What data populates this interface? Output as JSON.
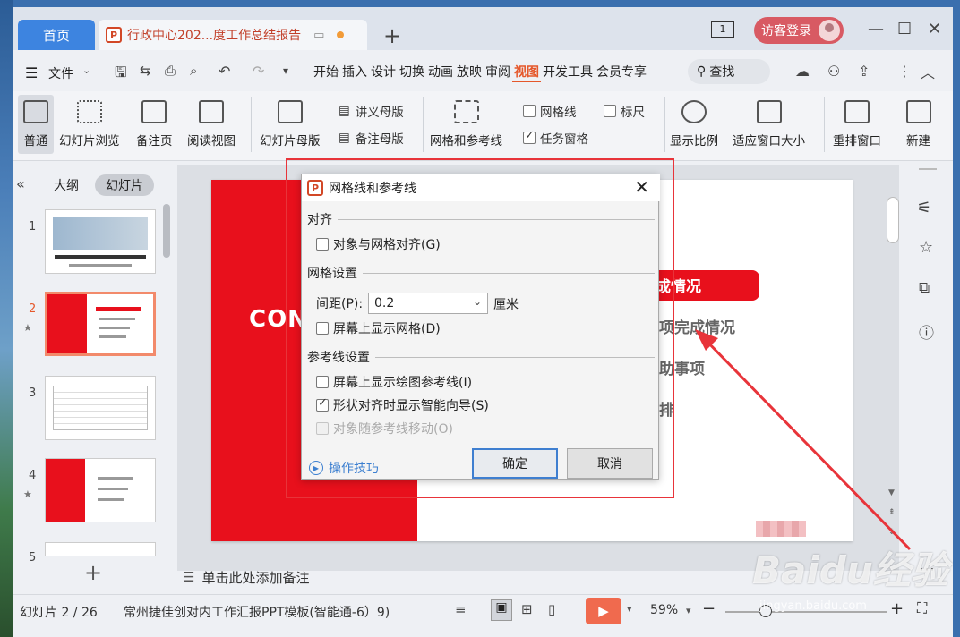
{
  "tabs": {
    "home": "首页",
    "doc": "行政中心202...度工作总结报告"
  },
  "titlebar": {
    "window_count": "1",
    "login": "访客登录"
  },
  "menu": {
    "file": "文件",
    "tabs": [
      "开始",
      "插入",
      "设计",
      "切换",
      "动画",
      "放映",
      "审阅",
      "视图",
      "开发工具",
      "会员专享"
    ],
    "active_tab": "视图",
    "search": "查找"
  },
  "ribbon": {
    "normal": "普通",
    "slide_browse": "幻灯片浏览",
    "notes_page": "备注页",
    "reading_view": "阅读视图",
    "slide_master": "幻灯片母版",
    "handout_master": "讲义母版",
    "notes_master": "备注母版",
    "grid_guides": "网格和参考线",
    "gridlines": "网格线",
    "ruler": "标尺",
    "task_pane": "任务窗格",
    "zoom": "显示比例",
    "fit_window": "适应窗口大小",
    "arrange_window": "重排窗口",
    "new_window": "新建"
  },
  "left_panel": {
    "outline_tab": "大纲",
    "slides_tab": "幻灯片",
    "slide_numbers": [
      "1",
      "2",
      "3",
      "4",
      "5"
    ],
    "selected": "2"
  },
  "slide": {
    "contents": "CONT",
    "bar_text": "成情况",
    "items": [
      "项完成情况",
      "助事项",
      "排"
    ]
  },
  "dialog": {
    "title": "网格线和参考线",
    "align_section": "对齐",
    "snap_to_grid": "对象与网格对齐(G)",
    "grid_section": "网格设置",
    "spacing_label": "间距(P):",
    "spacing_value": "0.2",
    "spacing_unit": "厘米",
    "show_grid": "屏幕上显示网格(D)",
    "guide_section": "参考线设置",
    "show_guides": "屏幕上显示绘图参考线(I)",
    "smart_guides": "形状对齐时显示智能向导(S)",
    "move_with_guides": "对象随参考线移动(O)",
    "tips": "操作技巧",
    "ok": "确定",
    "cancel": "取消"
  },
  "notes": "单击此处添加备注",
  "status": {
    "slide_index": "幻灯片 2 / 26",
    "template": "常州捷佳创对内工作汇报PPT模板(智能通-6）9)",
    "zoom": "59%"
  },
  "watermark": {
    "brand": "Baidu经验",
    "url": "jingyan.baidu.com"
  },
  "colors": {
    "accent": "#e5572a",
    "slide_red": "#e8101c",
    "highlight_box": "#e8343a",
    "home_tab": "#3d84e0"
  }
}
